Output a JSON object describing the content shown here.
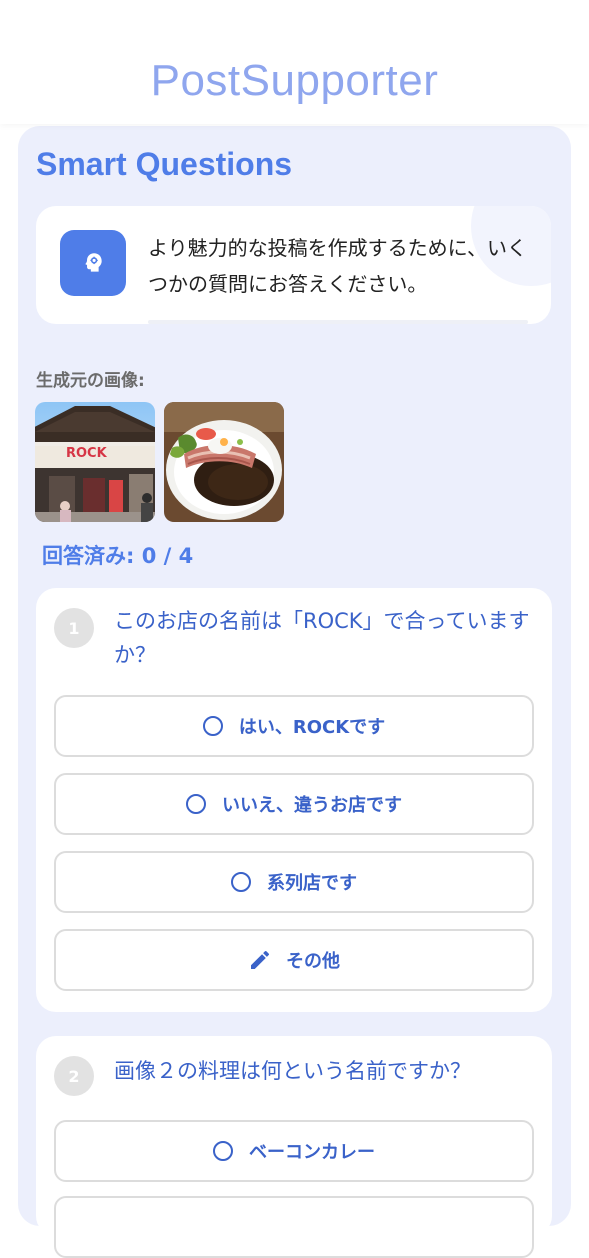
{
  "header": {
    "title": "PostSupporter"
  },
  "section": {
    "title": "Smart Questions"
  },
  "intro": {
    "text": "より魅力的な投稿を作成するために、いくつかの質問にお答えください。"
  },
  "source": {
    "label": "生成元の画像:"
  },
  "progress": {
    "text": "回答済み: 0 / 4",
    "answered": 0,
    "total": 4
  },
  "questions": [
    {
      "number": "1",
      "text": "このお店の名前は「ROCK」で合っていますか？",
      "options": [
        "はい、ROCKです",
        "いいえ、違うお店です",
        "系列店です",
        "その他"
      ]
    },
    {
      "number": "2",
      "text": "画像２の料理は何という名前ですか？",
      "options": [
        "ベーコンカレー"
      ]
    }
  ],
  "icons": {
    "intro": "brain-gear-icon",
    "radio": "radio-empty-icon",
    "other": "pencil-icon"
  },
  "colors": {
    "accent": "#4f7de8",
    "panel": "#eceffc",
    "title": "#8fa6ee"
  }
}
